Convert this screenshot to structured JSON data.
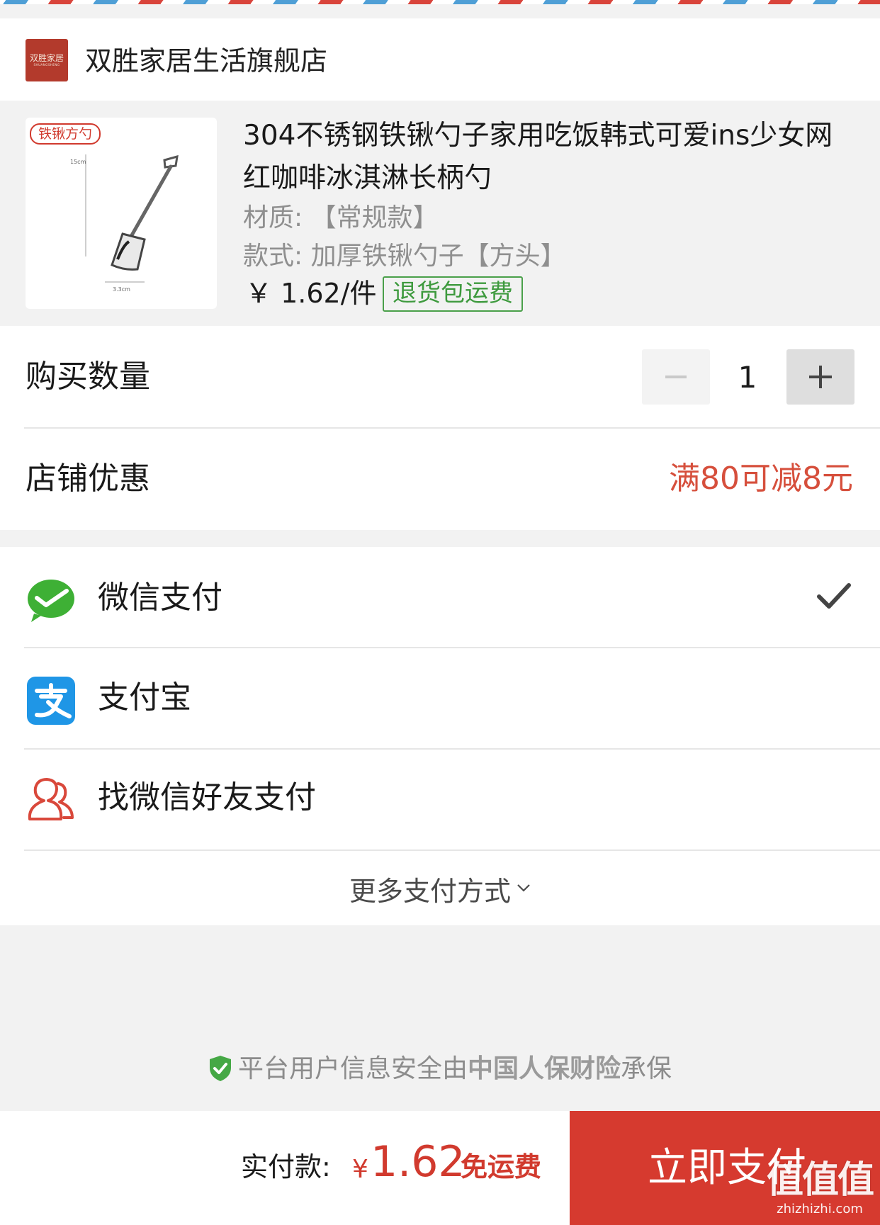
{
  "store": {
    "name": "双胜家居生活旗舰店",
    "logo_text": "双胜家居",
    "logo_subtext": "SHUANGSHENG"
  },
  "product": {
    "image_tag": "铁锹方勺",
    "image_dim_height": "15cm",
    "image_dim_width": "3.3cm",
    "title": "304不锈钢铁锹勺子家用吃饭韩式可爱ins少女网红咖啡冰淇淋长柄勺",
    "material": "材质: 【常规款】",
    "style": "款式: 加厚铁锹勺子【方头】",
    "price": "￥ 1.62/件",
    "return_badge": "退货包运费"
  },
  "quantity": {
    "label": "购买数量",
    "value": "1",
    "minus_symbol": "−",
    "plus_symbol": "+"
  },
  "promotion": {
    "label": "店铺优惠",
    "value": "满80可减8元"
  },
  "payment": {
    "options": [
      {
        "label": "微信支付",
        "icon": "wechat-pay-icon",
        "selected": true
      },
      {
        "label": "支付宝",
        "icon": "alipay-icon",
        "selected": false
      },
      {
        "label": "找微信好友支付",
        "icon": "friends-pay-icon",
        "selected": false
      }
    ],
    "more_label": "更多支付方式"
  },
  "security": {
    "prefix": "平台用户信息安全由",
    "insurer": "中国人保财险",
    "suffix": "承保"
  },
  "checkout": {
    "total_label": "实付款:",
    "currency": "¥",
    "amount": "1.62",
    "shipping": "免运费",
    "pay_button": "立即支付"
  },
  "watermark": {
    "logo": "值值值",
    "site": "zhizhizhi.com"
  },
  "colors": {
    "accent_red": "#d63a2f",
    "promo_red": "#d64f3c",
    "wechat_green": "#3eb035",
    "alipay_blue": "#1f96e6",
    "badge_green": "#4aa04a"
  }
}
